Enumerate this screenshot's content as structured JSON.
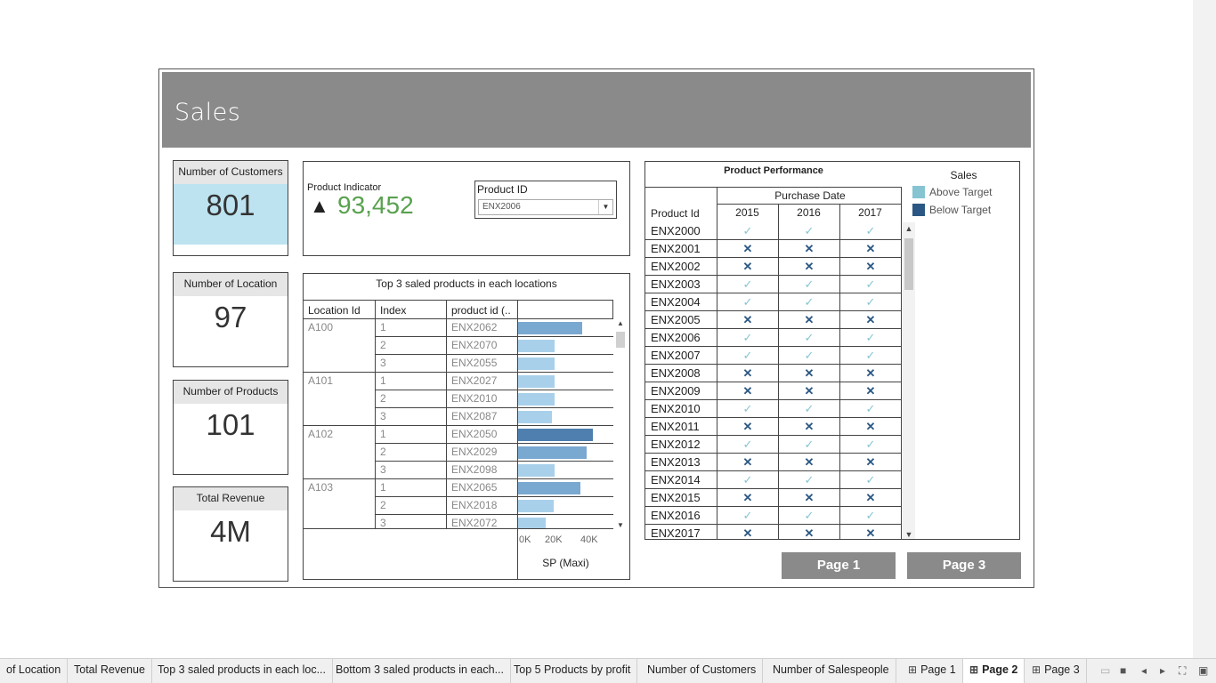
{
  "dashboard": {
    "title": "Sales"
  },
  "kpis": [
    {
      "label": "Number of Customers",
      "value": "801"
    },
    {
      "label": "Number of Location",
      "value": "97"
    },
    {
      "label": "Number of Products",
      "value": "101"
    },
    {
      "label": "Total Revenue",
      "value": "4M"
    }
  ],
  "product_indicator": {
    "label": "Product Indicator",
    "arrow": "▲",
    "value": "93,452",
    "value_color": "#59a14f",
    "filter_label": "Product ID",
    "filter_value": "ENX2006"
  },
  "top3": {
    "title": "Top 3 saled products in each locations",
    "columns": [
      "Location Id",
      "Index",
      "product id (..",
      ""
    ],
    "axis_ticks": [
      "0K",
      "20K",
      "40K"
    ],
    "axis_label": "SP (Maxi)"
  },
  "chart_data": {
    "type": "bar",
    "title": "Top 3 saled products in each locations",
    "xlabel": "SP (Maxi)",
    "xlim": [
      0,
      52000
    ],
    "x_ticks": [
      "0K",
      "20K",
      "40K"
    ],
    "groups": [
      {
        "location": "A100",
        "rows": [
          {
            "index": "1",
            "product": "ENX2062",
            "value": 35000
          },
          {
            "index": "2",
            "product": "ENX2070",
            "value": 20000
          },
          {
            "index": "3",
            "product": "ENX2055",
            "value": 20000
          }
        ]
      },
      {
        "location": "A101",
        "rows": [
          {
            "index": "1",
            "product": "ENX2027",
            "value": 20000
          },
          {
            "index": "2",
            "product": "ENX2010",
            "value": 20000
          },
          {
            "index": "3",
            "product": "ENX2087",
            "value": 18500
          }
        ]
      },
      {
        "location": "A102",
        "rows": [
          {
            "index": "1",
            "product": "ENX2050",
            "value": 41000
          },
          {
            "index": "2",
            "product": "ENX2029",
            "value": 37500
          },
          {
            "index": "3",
            "product": "ENX2098",
            "value": 20000
          }
        ]
      },
      {
        "location": "A103",
        "rows": [
          {
            "index": "1",
            "product": "ENX2065",
            "value": 34000
          },
          {
            "index": "2",
            "product": "ENX2018",
            "value": 19500
          },
          {
            "index": "3",
            "product": "ENX2072",
            "value": 15000
          }
        ]
      }
    ],
    "colors": {
      "high": "#4e7fae",
      "mid": "#79a8d0",
      "low": "#a9d0ea"
    }
  },
  "performance": {
    "title": "Product Performance",
    "header_group": "Purchase Date",
    "id_header": "Product Id",
    "years": [
      "2015",
      "2016",
      "2017"
    ],
    "check_symbol": "✓",
    "cross_symbol": "✕",
    "rows": [
      {
        "id": "ENX2000",
        "ok": true
      },
      {
        "id": "ENX2001",
        "ok": false
      },
      {
        "id": "ENX2002",
        "ok": false
      },
      {
        "id": "ENX2003",
        "ok": true
      },
      {
        "id": "ENX2004",
        "ok": true
      },
      {
        "id": "ENX2005",
        "ok": false
      },
      {
        "id": "ENX2006",
        "ok": true
      },
      {
        "id": "ENX2007",
        "ok": true
      },
      {
        "id": "ENX2008",
        "ok": false
      },
      {
        "id": "ENX2009",
        "ok": false
      },
      {
        "id": "ENX2010",
        "ok": true
      },
      {
        "id": "ENX2011",
        "ok": false
      },
      {
        "id": "ENX2012",
        "ok": true
      },
      {
        "id": "ENX2013",
        "ok": false
      },
      {
        "id": "ENX2014",
        "ok": true
      },
      {
        "id": "ENX2015",
        "ok": false
      },
      {
        "id": "ENX2016",
        "ok": true
      },
      {
        "id": "ENX2017",
        "ok": false
      }
    ],
    "legend_title": "Sales",
    "legend": [
      {
        "label": "Above Target",
        "color": "#86c4d2"
      },
      {
        "label": "Below Target",
        "color": "#2a5783"
      }
    ]
  },
  "nav": {
    "page1": "Page 1",
    "page3": "Page 3"
  },
  "tabs": [
    {
      "label": "of Location",
      "icon": ""
    },
    {
      "label": "Total Revenue",
      "icon": ""
    },
    {
      "label": "Top 3 saled products in each loc...",
      "icon": ""
    },
    {
      "label": "Bottom 3 saled products in each...",
      "icon": ""
    },
    {
      "label": "Top 5 Products by profit",
      "icon": ""
    },
    {
      "label": "Number of Customers",
      "icon": ""
    },
    {
      "label": "Number of Salespeople",
      "icon": ""
    },
    {
      "label": "Page 1",
      "icon": "⊞"
    },
    {
      "label": "Page 2",
      "icon": "⊞",
      "active": true
    },
    {
      "label": "Page 3",
      "icon": "⊞"
    }
  ]
}
